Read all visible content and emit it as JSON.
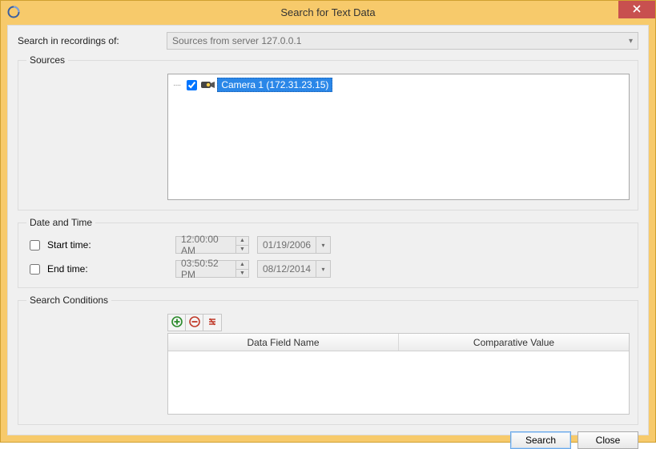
{
  "window": {
    "title": "Search for Text Data"
  },
  "top": {
    "label": "Search in recordings of:",
    "combo_value": "Sources from server 127.0.0.1"
  },
  "sources": {
    "legend": "Sources",
    "items": [
      {
        "checked": true,
        "label": "Camera 1 (172.31.23.15)"
      }
    ]
  },
  "datetime": {
    "legend": "Date and Time",
    "start": {
      "label": "Start time:",
      "checked": false,
      "time": "12:00:00 AM",
      "date": "01/19/2006"
    },
    "end": {
      "label": "End time:",
      "checked": false,
      "time": "03:50:52 PM",
      "date": "08/12/2014"
    }
  },
  "conditions": {
    "legend": "Search Conditions",
    "columns": [
      "Data Field Name",
      "Comparative Value"
    ],
    "rows": []
  },
  "footer": {
    "search": "Search",
    "close": "Close"
  }
}
